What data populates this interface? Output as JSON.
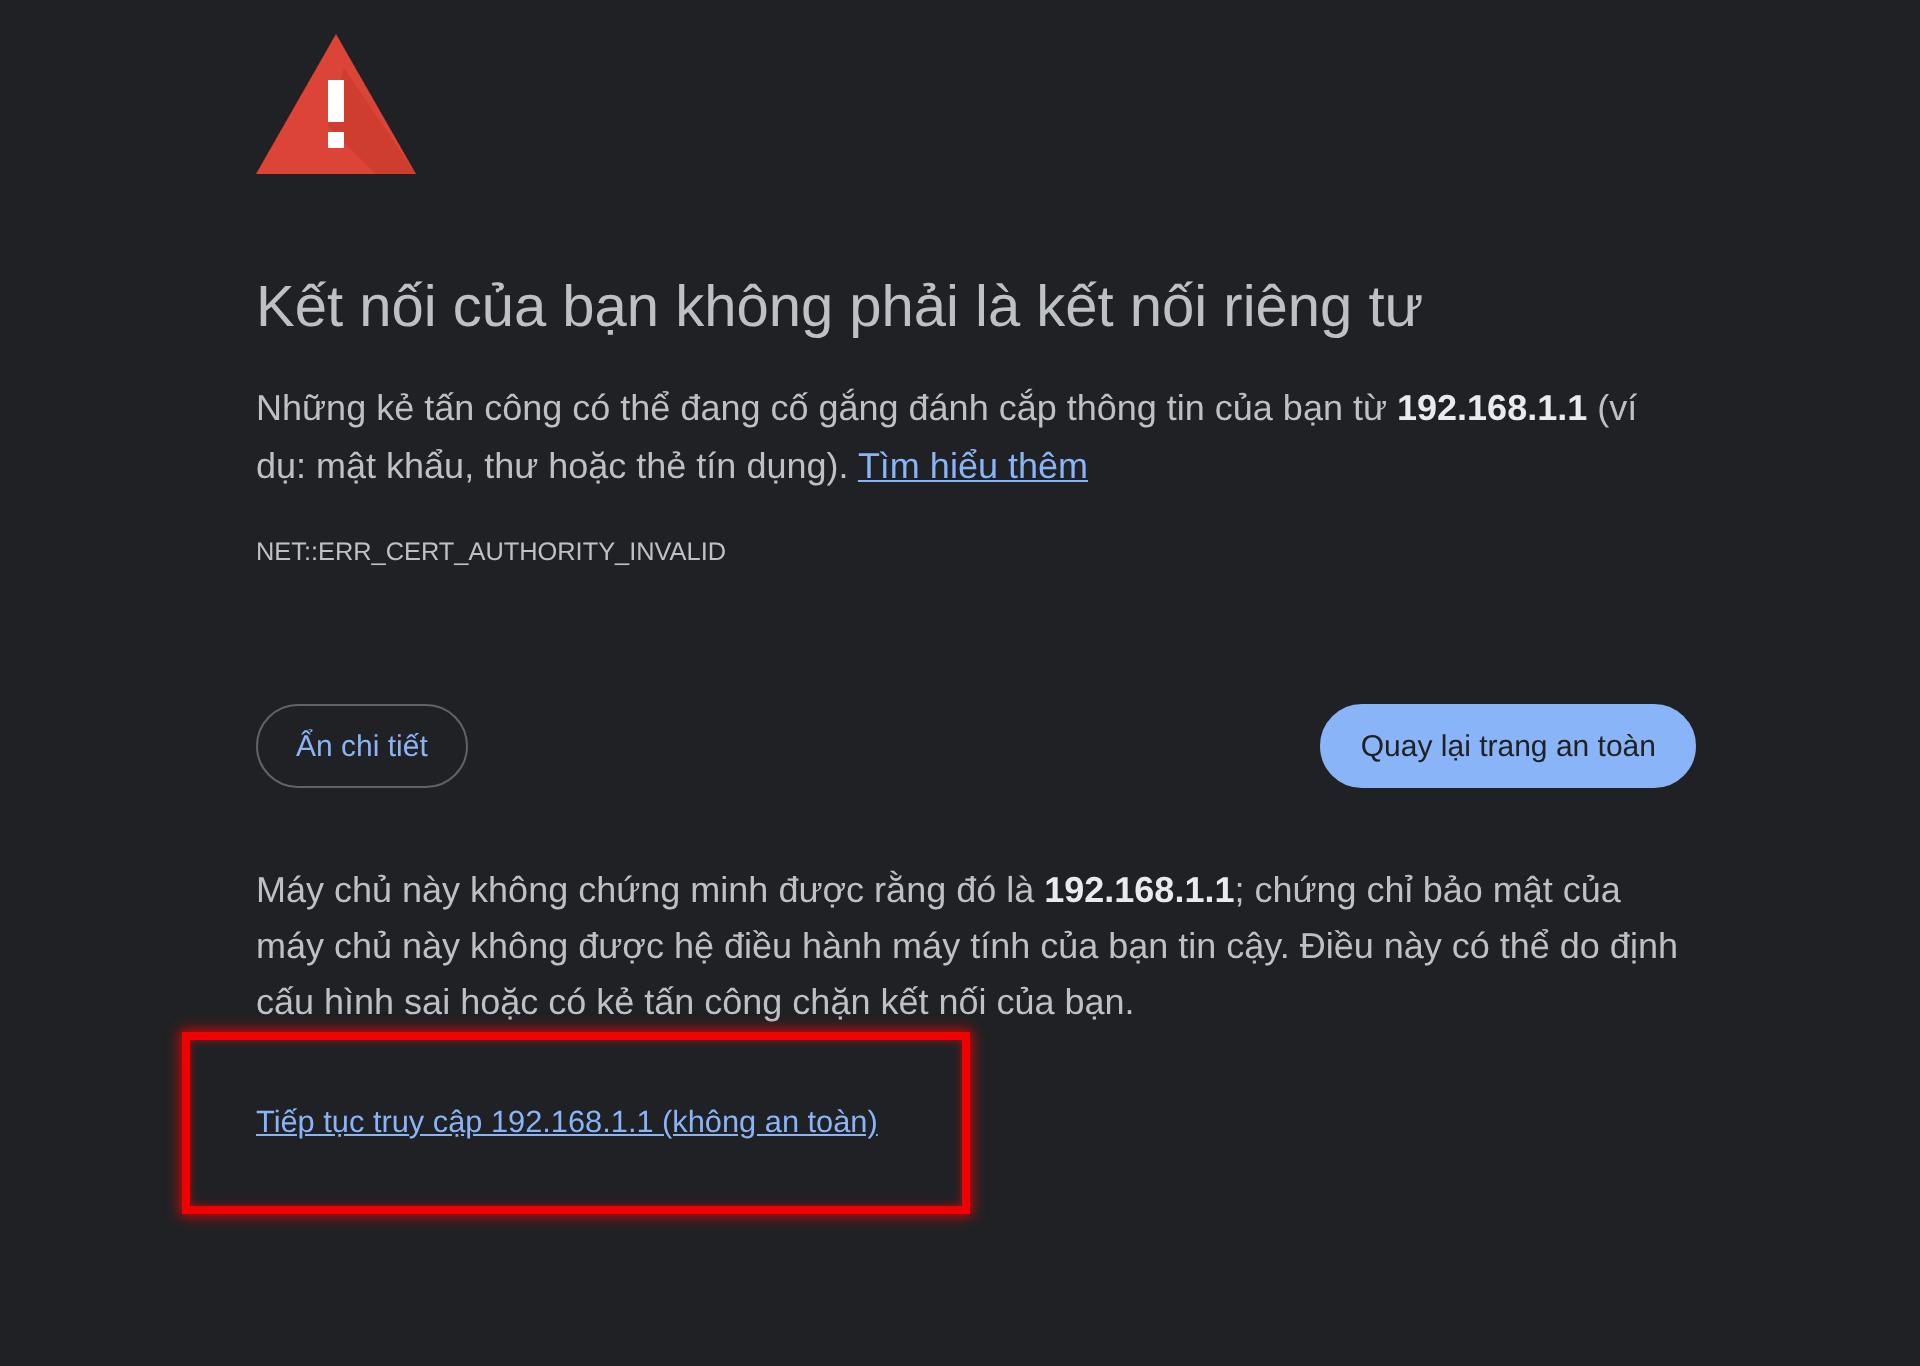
{
  "page": {
    "title": "Kết nối của bạn không phải là kết nối riêng tư",
    "description": {
      "text": "Những kẻ tấn công có thể đang cố gắng đánh cắp thông tin của bạn từ **192.168.1.1** (ví dụ: mật khẩu, thư hoặc thẻ tín dụng).",
      "link": "Tìm hiểu thêm"
    },
    "error_code": "NET::ERR_CERT_AUTHORITY_INVALID"
  },
  "buttons": [
    {
      "label": "Ẩn chi tiết",
      "kind": "secondary"
    },
    {
      "label": "Quay lại trang an toàn",
      "kind": "primary"
    }
  ],
  "details": {
    "text": "Máy chủ này không chứng minh được rằng đó là **192.168.1.1**; chứng chỉ bảo mật của máy chủ này không được hệ điều hành máy tính của bạn tin cậy. Điều này có thể do định cấu hình sai hoặc có kẻ tấn công chặn kết nối của bạn.",
    "proceed_link": "Tiếp tục truy cập 192.168.1.1 (không an toàn)",
    "highlighted": true
  }
}
